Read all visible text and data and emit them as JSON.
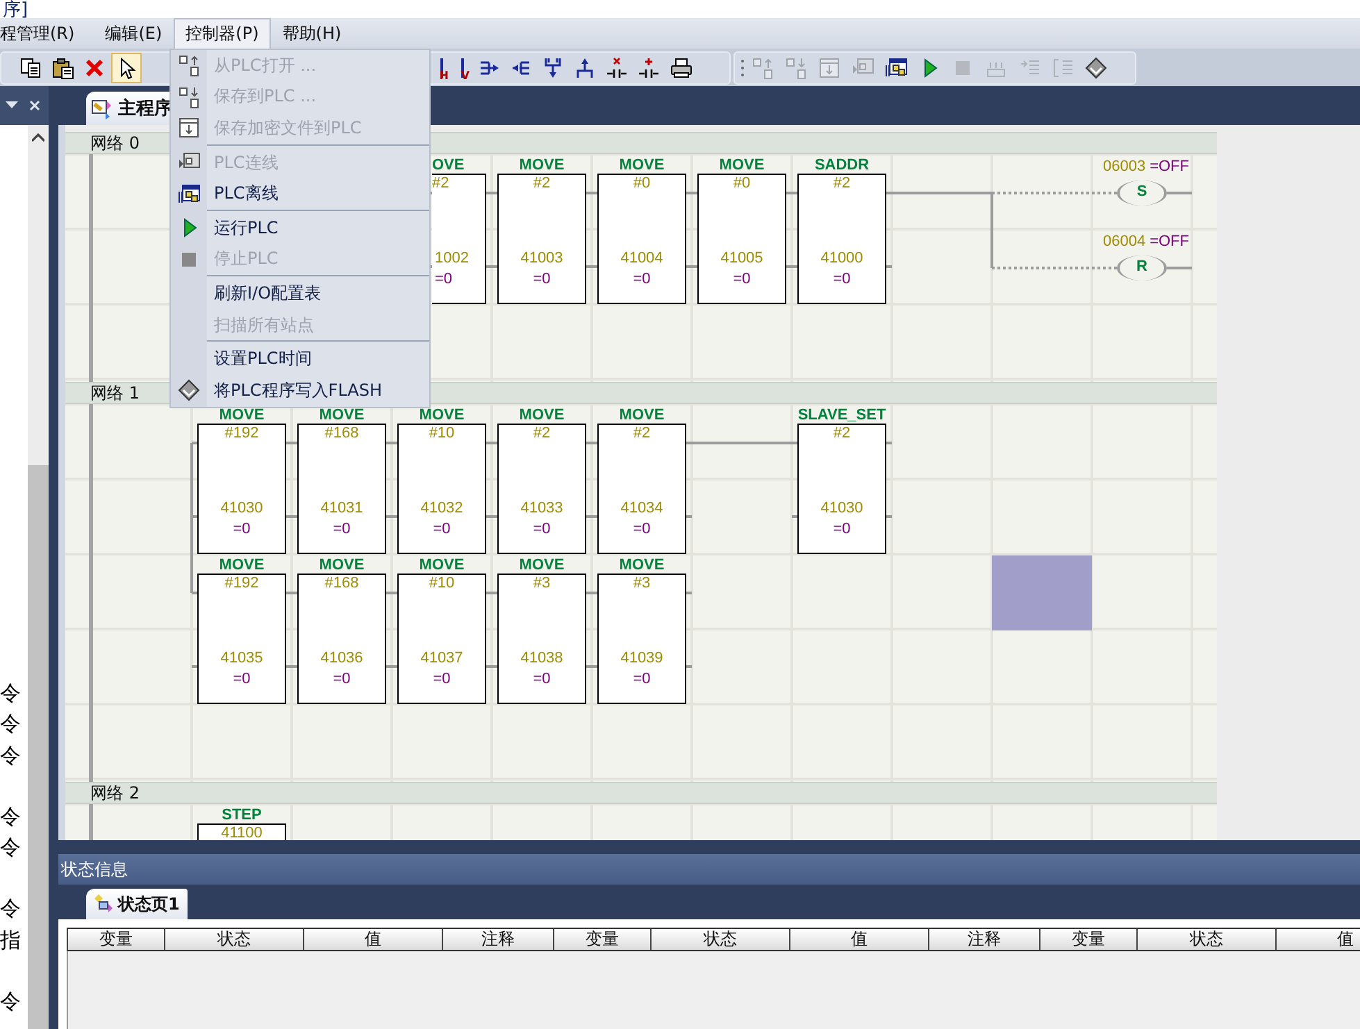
{
  "window": {
    "title": "序]"
  },
  "menu_bar": [
    {
      "label": "程管理(R)",
      "selected": false
    },
    {
      "label": "编辑(E)",
      "selected": false
    },
    {
      "label": "控制器(P)",
      "selected": true
    },
    {
      "label": "帮助(H)",
      "selected": false
    }
  ],
  "toolbar": {
    "edit_tools": [
      {
        "selected": false
      },
      {
        "selected": false
      },
      {
        "selected": false
      },
      {
        "selected": true
      }
    ],
    "ladder_tools": [
      {
        "text": "H"
      },
      {
        "text": "V"
      }
    ],
    "plc_tools": [
      {
        "disabled": true
      },
      {
        "disabled": true
      },
      {
        "disabled": true
      },
      {
        "disabled": true
      },
      {
        "disabled": false
      },
      {
        "disabled": false
      },
      {
        "disabled": true
      },
      {
        "disabled": true
      },
      {
        "disabled": true
      },
      {
        "disabled": true
      },
      {
        "disabled": false
      }
    ]
  },
  "menu": {
    "items": [
      {
        "kind": "item",
        "label": "从PLC打开 ...",
        "disabled": true
      },
      {
        "kind": "item",
        "label": "保存到PLC ...",
        "disabled": true
      },
      {
        "kind": "item",
        "label": "保存加密文件到PLC",
        "disabled": true
      },
      {
        "kind": "separator"
      },
      {
        "kind": "item",
        "label": "PLC连线",
        "disabled": true
      },
      {
        "kind": "item",
        "label": "PLC离线",
        "disabled": false
      },
      {
        "kind": "separator"
      },
      {
        "kind": "item",
        "label": "运行PLC",
        "disabled": false
      },
      {
        "kind": "item",
        "label": "停止PLC",
        "disabled": true
      },
      {
        "kind": "separator"
      },
      {
        "kind": "item",
        "label": "刷新I/O配置表",
        "disabled": false
      },
      {
        "kind": "item",
        "label": "扫描所有站点",
        "disabled": true
      },
      {
        "kind": "separator"
      },
      {
        "kind": "item",
        "label": "设置PLC时间",
        "disabled": false
      },
      {
        "kind": "item",
        "label": "将PLC程序写入FLASH",
        "disabled": false
      }
    ]
  },
  "doc_tabs": [
    {
      "label": "主程序",
      "selected": true
    }
  ],
  "left_panel": {
    "groups": [
      [
        "令",
        "令",
        "令"
      ],
      [
        "令",
        "令"
      ],
      [
        "令",
        "指"
      ],
      [
        "令"
      ]
    ]
  },
  "networks": [
    {
      "label": "网络 0",
      "rows": [
        [
          {
            "kind": "empty"
          },
          {
            "kind": "empty"
          },
          {
            "kind": "empty"
          },
          {
            "kind": "box_cut",
            "name": "OVE",
            "input": "#2",
            "address": "1002",
            "value": "=0"
          },
          {
            "kind": "box",
            "name": "MOVE",
            "input": "#2",
            "address": "41003",
            "value": "=0"
          },
          {
            "kind": "box",
            "name": "MOVE",
            "input": "#0",
            "address": "41004",
            "value": "=0"
          },
          {
            "kind": "box",
            "name": "MOVE",
            "input": "#0",
            "address": "41005",
            "value": "=0"
          },
          {
            "kind": "box",
            "name": "SADDR",
            "input": "#2",
            "address": "41000",
            "value": "=0"
          },
          {
            "kind": "empty"
          },
          {
            "kind": "empty"
          },
          {
            "kind": "coils",
            "coils": [
              {
                "letter": "S",
                "address": "06003",
                "value": "=OFF"
              },
              {
                "letter": "R",
                "address": "06004",
                "value": "=OFF"
              }
            ]
          }
        ]
      ]
    },
    {
      "label": "网络 1",
      "rows": [
        [
          {
            "kind": "empty"
          },
          {
            "kind": "box",
            "name": "MOVE",
            "input": "#192",
            "address": "41030",
            "value": "=0"
          },
          {
            "kind": "box",
            "name": "MOVE",
            "input": "#168",
            "address": "41031",
            "value": "=0"
          },
          {
            "kind": "box",
            "name": "MOVE",
            "input": "#10",
            "address": "41032",
            "value": "=0"
          },
          {
            "kind": "box",
            "name": "MOVE",
            "input": "#2",
            "address": "41033",
            "value": "=0"
          },
          {
            "kind": "box",
            "name": "MOVE",
            "input": "#2",
            "address": "41034",
            "value": "=0"
          },
          {
            "kind": "empty"
          },
          {
            "kind": "box",
            "name": "SLAVE_SET",
            "input": "#2",
            "address": "41030",
            "value": "=0"
          }
        ],
        [
          {
            "kind": "empty"
          },
          {
            "kind": "box",
            "name": "MOVE",
            "input": "#192",
            "address": "41035",
            "value": "=0"
          },
          {
            "kind": "box",
            "name": "MOVE",
            "input": "#168",
            "address": "41036",
            "value": "=0"
          },
          {
            "kind": "box",
            "name": "MOVE",
            "input": "#10",
            "address": "41037",
            "value": "=0"
          },
          {
            "kind": "box",
            "name": "MOVE",
            "input": "#3",
            "address": "41038",
            "value": "=0"
          },
          {
            "kind": "box",
            "name": "MOVE",
            "input": "#3",
            "address": "41039",
            "value": "=0"
          },
          {
            "kind": "empty"
          },
          {
            "kind": "empty"
          },
          {
            "kind": "empty"
          },
          {
            "kind": "cursor"
          }
        ]
      ]
    },
    {
      "label": "网络 2",
      "rows": [
        [
          {
            "kind": "empty"
          },
          {
            "kind": "box",
            "name": "STEP",
            "input": "41100"
          }
        ]
      ]
    }
  ],
  "status": {
    "title": "状态信息",
    "tabs": [
      {
        "label": "状态页1",
        "selected": true
      }
    ],
    "columns": [
      "变量",
      "状态",
      "值",
      "注释",
      "变量",
      "状态",
      "值",
      "注释",
      "变量",
      "状态",
      "值"
    ]
  }
}
